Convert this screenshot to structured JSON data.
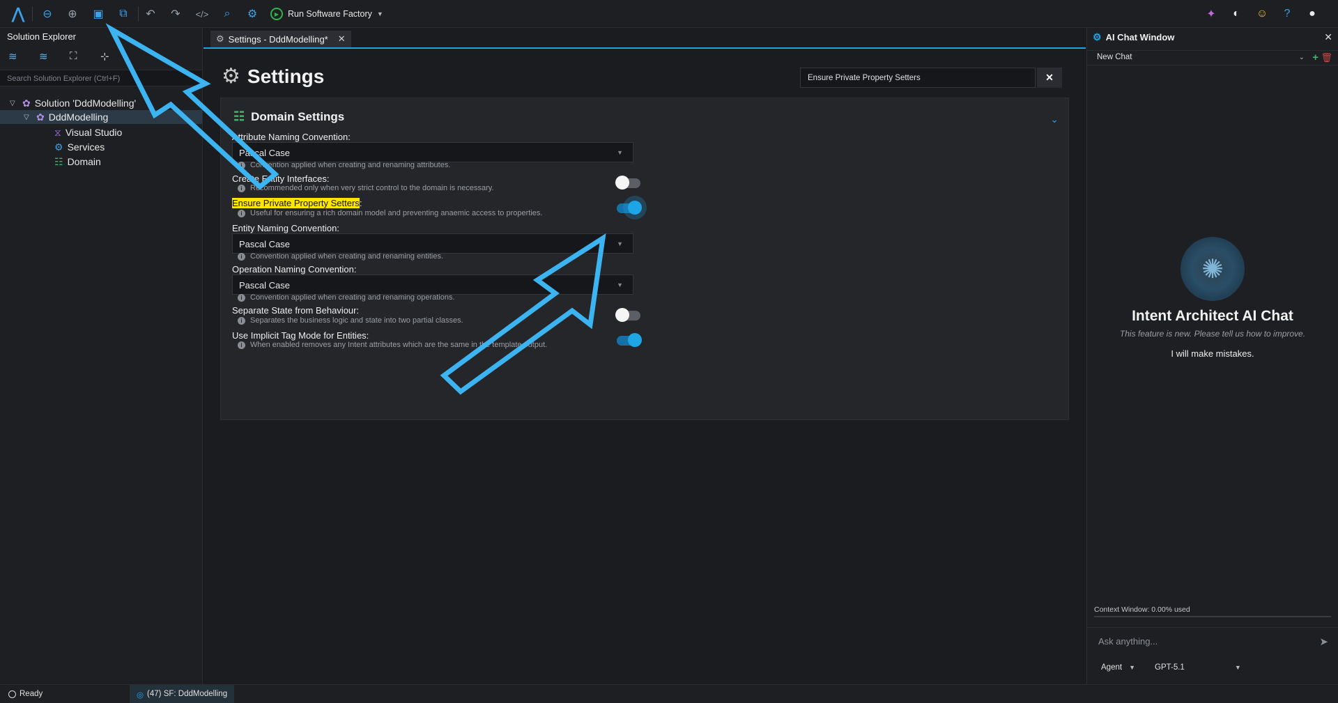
{
  "toolbar": {
    "run_label": "Run Software Factory",
    "icons": [
      "app-logo-icon",
      "back-icon",
      "forward-icon",
      "save-icon",
      "save-all-icon",
      "undo-icon",
      "redo-icon",
      "code-icon",
      "search-icon",
      "settings-icon",
      "run-icon",
      "gift-icon",
      "theme-icon",
      "smiley-icon",
      "help-icon",
      "account-icon"
    ]
  },
  "solution_explorer": {
    "title": "Solution Explorer",
    "search_placeholder": "Search Solution Explorer (Ctrl+F)",
    "tree": [
      {
        "label": "Solution 'DddModelling'",
        "icon": "solution-icon"
      },
      {
        "label": "DddModelling",
        "icon": "application-icon"
      },
      {
        "label": "Visual Studio",
        "icon": "visual-studio-icon"
      },
      {
        "label": "Services",
        "icon": "services-icon"
      },
      {
        "label": "Domain",
        "icon": "domain-icon"
      }
    ]
  },
  "tab": {
    "label": "Settings - DddModelling*"
  },
  "settings": {
    "title": "Settings",
    "filter_value": "Ensure Private Property Setters",
    "section_title": "Domain Settings",
    "items": [
      {
        "label": "Attribute Naming Convention:",
        "value": "Pascal Case",
        "hint": "Convention applied when creating and renaming attributes."
      },
      {
        "label": "Create Entity Interfaces:",
        "hint": "Recommended only when very strict control to the domain is necessary.",
        "enabled": false
      },
      {
        "label_highlight": "Ensure Private Property Setters",
        "label_suffix": ":",
        "hint": "Useful for ensuring a rich domain model and preventing anaemic access to properties.",
        "enabled": true
      },
      {
        "label": "Entity Naming Convention:",
        "value": "Pascal Case",
        "hint": "Convention applied when creating and renaming entities."
      },
      {
        "label": "Operation Naming Convention:",
        "value": "Pascal Case",
        "hint": "Convention applied when creating and renaming operations."
      },
      {
        "label": "Separate State from Behaviour:",
        "hint": "Separates the business logic and state into two partial classes.",
        "enabled": false
      },
      {
        "label": "Use Implicit Tag Mode for Entities:",
        "hint": "When enabled removes any Intent attributes which are the same in the template output.",
        "enabled": true
      }
    ]
  },
  "ai_chat": {
    "title": "AI Chat Window",
    "chat_select": "New Chat",
    "heading": "Intent Architect AI Chat",
    "subtitle": "This feature is new. Please tell us how to improve.",
    "message": "I will make mistakes.",
    "context": "Context Window: 0.00% used",
    "input_placeholder": "Ask anything...",
    "mode": "Agent",
    "model": "GPT-5.1"
  },
  "status": {
    "ready": "Ready",
    "sf": "(47) SF: DddModelling"
  },
  "colors": {
    "accent": "#1ea5e6",
    "highlight": "#ffe600",
    "annotation_arrow": "#3db4f2"
  }
}
